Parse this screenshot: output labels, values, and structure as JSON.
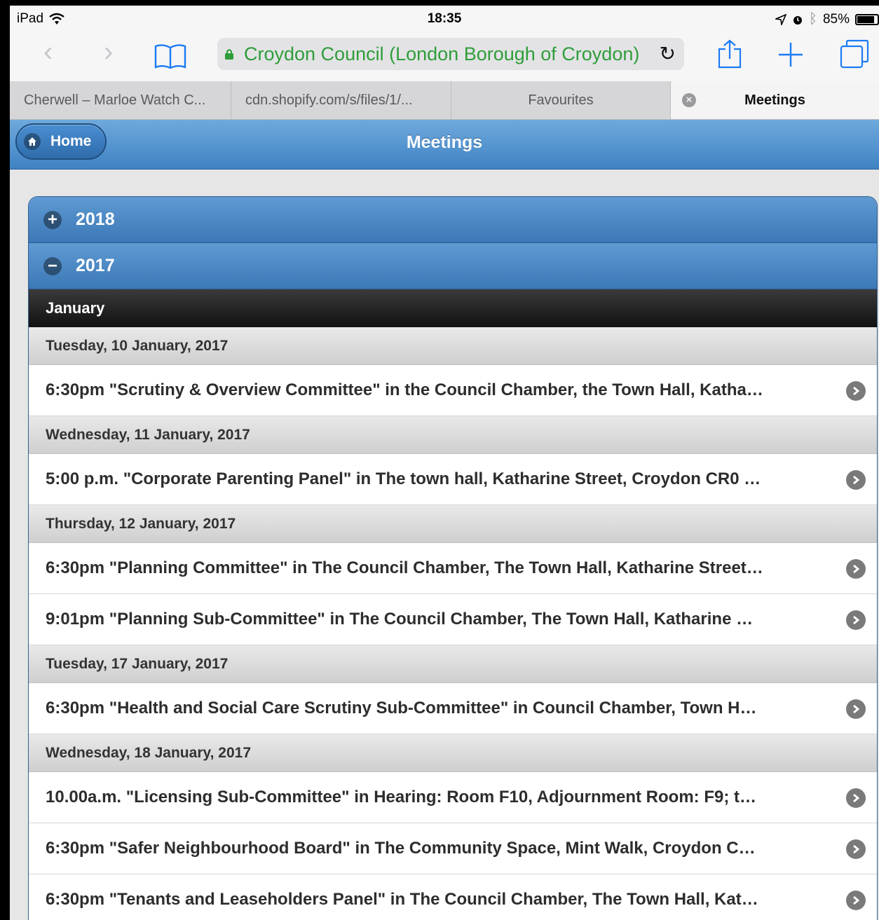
{
  "status_bar": {
    "device": "iPad",
    "time": "18:35",
    "battery": "85%",
    "battery_level": 0.85
  },
  "browser": {
    "address": "Croydon Council (London Borough of Croydon)",
    "tabs": [
      {
        "label": "Cherwell – Marloe Watch C..."
      },
      {
        "label": "cdn.shopify.com/s/files/1/..."
      },
      {
        "label": "Favourites"
      },
      {
        "label": "Meetings",
        "active": true
      }
    ]
  },
  "header": {
    "home_label": "Home",
    "title": "Meetings"
  },
  "years": [
    {
      "label": "2018",
      "expanded": false
    },
    {
      "label": "2017",
      "expanded": true
    }
  ],
  "month": "January",
  "days": [
    {
      "date": "Tuesday, 10 January, 2017",
      "meetings": [
        "6:30pm \"Scrutiny & Overview Committee\" in the Council Chamber, the Town Hall, Katha…"
      ]
    },
    {
      "date": "Wednesday, 11 January, 2017",
      "meetings": [
        "5:00 p.m. \"Corporate Parenting Panel\" in The town hall, Katharine Street, Croydon CR0 …"
      ]
    },
    {
      "date": "Thursday, 12 January, 2017",
      "meetings": [
        "6:30pm \"Planning Committee\" in The Council Chamber, The Town Hall, Katharine Street…",
        "9:01pm \"Planning Sub-Committee\" in The Council Chamber, The Town Hall, Katharine …"
      ]
    },
    {
      "date": "Tuesday, 17 January, 2017",
      "meetings": [
        "6:30pm \"Health and Social Care Scrutiny Sub-Committee\" in Council Chamber, Town H…"
      ]
    },
    {
      "date": "Wednesday, 18 January, 2017",
      "meetings": [
        "10.00a.m. \"Licensing Sub-Committee\" in Hearing: Room F10, Adjournment Room: F9; t…",
        "6:30pm \"Safer Neighbourhood Board\" in The Community Space, Mint Walk, Croydon C…",
        "6:30pm \"Tenants and Leaseholders Panel\" in The Council Chamber, The Town Hall, Kat…"
      ]
    }
  ]
}
